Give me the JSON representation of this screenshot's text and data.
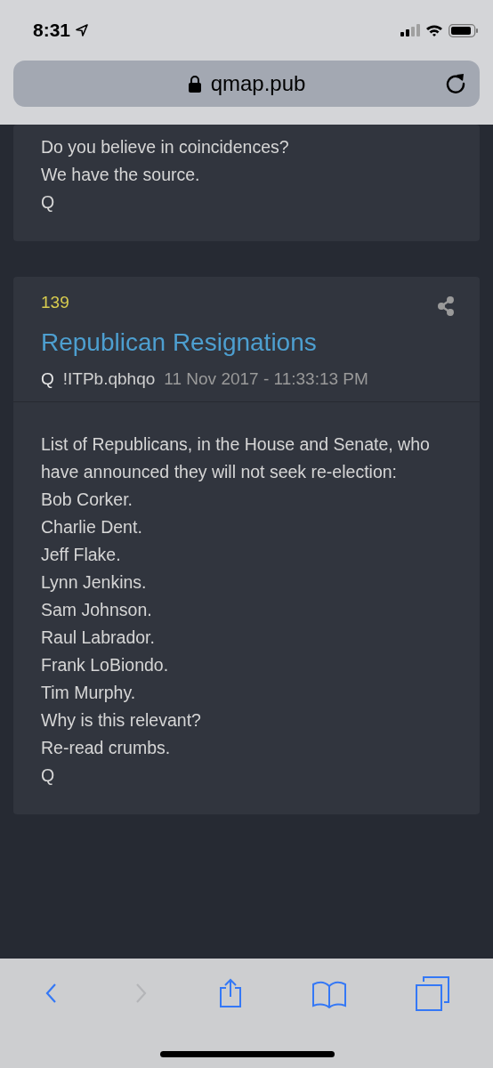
{
  "status_bar": {
    "time": "8:31"
  },
  "address_bar": {
    "url": "qmap.pub"
  },
  "posts": [
    {
      "lines": [
        "Do you believe in coincidences?",
        "We have the source.",
        "Q"
      ]
    },
    {
      "number": "139",
      "title": "Republican Resignations",
      "author": "Q",
      "tripcode": "!ITPb.qbhqo",
      "timestamp": "11 Nov 2017 - 11:33:13 PM",
      "lines": [
        "List of Republicans, in the House and Senate, who have announced they will not seek re-election:",
        "Bob Corker.",
        "Charlie Dent.",
        "Jeff Flake.",
        "Lynn Jenkins.",
        "Sam Johnson.",
        "Raul Labrador.",
        "Frank LoBiondo.",
        "Tim Murphy.",
        "Why is this relevant?",
        "Re-read crumbs.",
        "Q"
      ]
    }
  ],
  "toolbar": [
    {
      "kind": "back",
      "disabled": false
    },
    {
      "kind": "forward",
      "disabled": true
    },
    {
      "kind": "share",
      "disabled": false
    },
    {
      "kind": "bookmarks",
      "disabled": false
    },
    {
      "kind": "tabs",
      "disabled": false
    }
  ]
}
